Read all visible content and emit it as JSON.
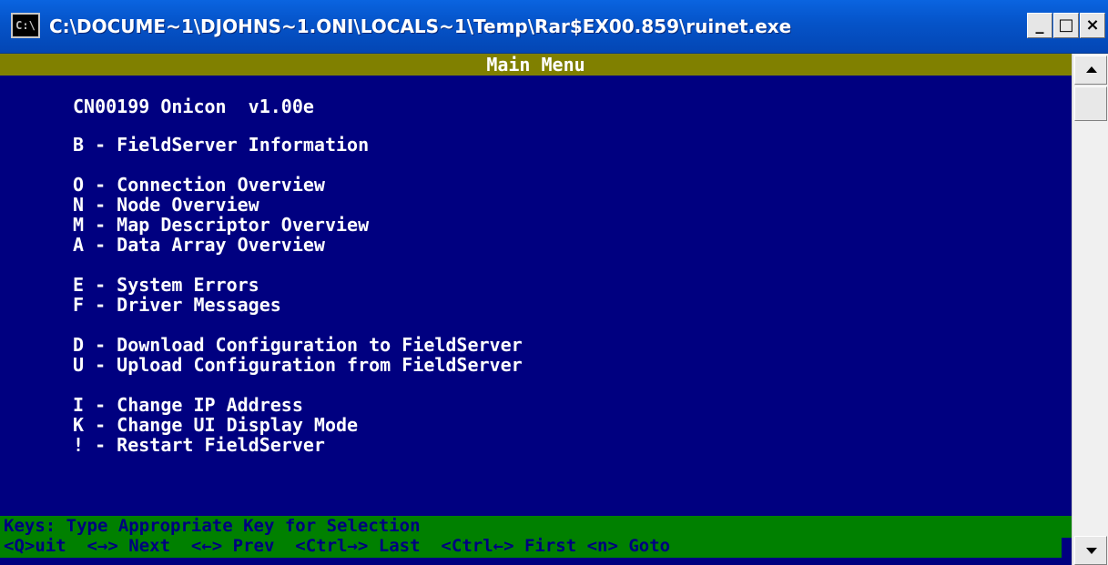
{
  "window": {
    "title": "C:\\DOCUME~1\\DJOHNS~1.ONI\\LOCALS~1\\Temp\\Rar$EX00.859\\ruinet.exe",
    "icon_label": "C:\\",
    "minimize_label": "_",
    "maximize_label": "□",
    "close_label": "×"
  },
  "console": {
    "header": "Main Menu",
    "version_line": "CN00199 Onicon  v1.00e",
    "menu_items": [
      "B - FieldServer Information",
      "O - Connection Overview",
      "N - Node Overview",
      "M - Map Descriptor Overview",
      "A - Data Array Overview",
      "E - System Errors",
      "F - Driver Messages",
      "D - Download Configuration to FieldServer",
      "U - Upload Configuration from FieldServer",
      "I - Change IP Address",
      "K - Change UI Display Mode",
      "! - Restart FieldServer"
    ],
    "footer_line_1": "Keys: Type Appropriate Key for Selection",
    "footer_line_2": "<Q>uit  <→> Next  <←> Prev  <Ctrl→> Last  <Ctrl←> First <n> Goto"
  },
  "colors": {
    "console_background": "#000080",
    "header_background": "#808000",
    "footer_background": "#008000",
    "footer_text": "#000080",
    "text": "#ffffff"
  },
  "icons": {
    "app": "console-icon",
    "scroll_up": "arrow-up-icon",
    "scroll_down": "arrow-down-icon"
  }
}
